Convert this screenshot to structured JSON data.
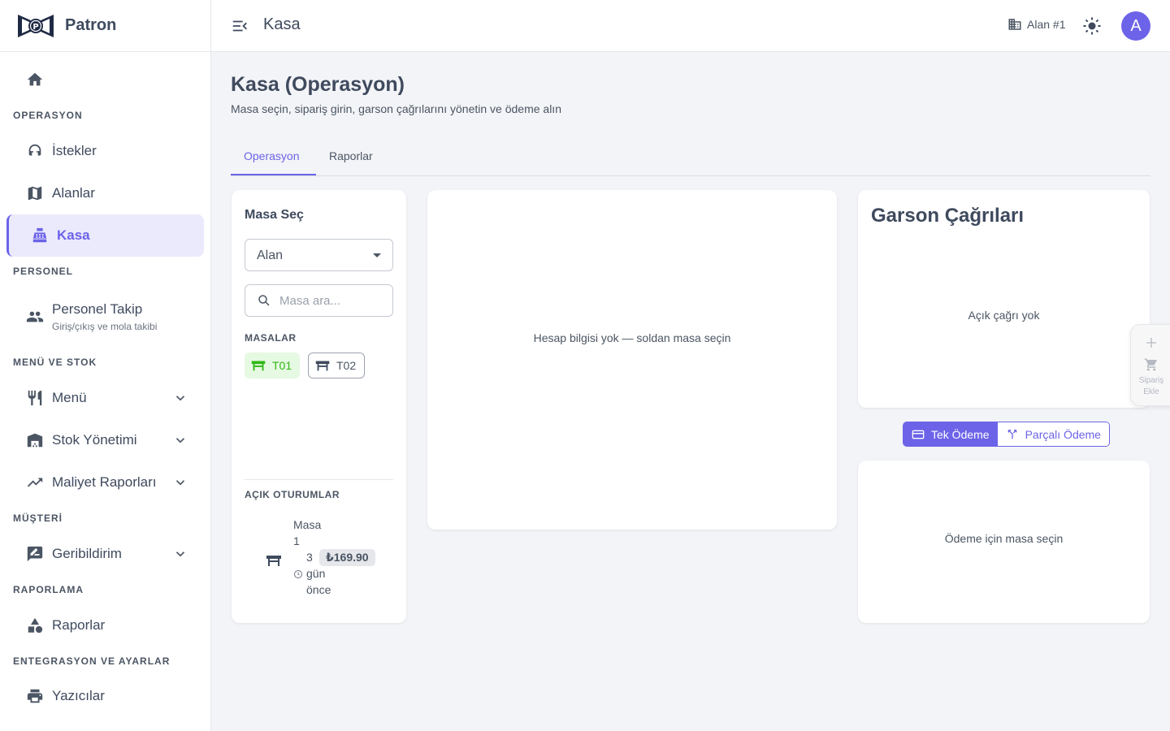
{
  "brand": {
    "name": "Patron"
  },
  "topbar": {
    "title": "Kasa",
    "area_label": "Alan #1",
    "avatar_initial": "A"
  },
  "sidebar": {
    "dashboard": "Dashboard",
    "sections": {
      "operasyon": "OPERASYON",
      "personel": "PERSONEL",
      "menu_stok": "MENÜ VE STOK",
      "musteri": "MÜŞTERİ",
      "raporlama": "RAPORLAMA",
      "entegrasyon": "ENTEGRASYON VE AYARLAR"
    },
    "items": {
      "istekler": "İstekler",
      "alanlar": "Alanlar",
      "kasa": "Kasa",
      "personel_takip": "Personel Takip",
      "personel_takip_sub": "Giriş/çıkış ve mola takibi",
      "menu": "Menü",
      "stok": "Stok Yönetimi",
      "maliyet": "Maliyet Raporları",
      "geribildirim": "Geribildirim",
      "raporlar": "Raporlar",
      "yazicilar": "Yazıcılar"
    }
  },
  "page": {
    "title": "Kasa (Operasyon)",
    "subtitle": "Masa seçin, sipariş girin, garson çağrılarını yönetin ve ödeme alın",
    "tabs": [
      "Operasyon",
      "Raporlar"
    ]
  },
  "masa_panel": {
    "title": "Masa Seç",
    "area_select": "Alan",
    "search_placeholder": "Masa ara...",
    "tables_label": "MASALAR",
    "tables": [
      "T01",
      "T02"
    ],
    "sessions_label": "AÇIK OTURUMLAR",
    "session": {
      "name": "Masa 1",
      "amount": "₺169.90",
      "ago_num": "3",
      "ago_text": "gün önce"
    }
  },
  "account_panel": {
    "empty": "Hesap bilgisi yok — soldan masa seçin"
  },
  "waiter_panel": {
    "title": "Garson Çağrıları",
    "empty": "Açık çağrı yok"
  },
  "payment": {
    "single": "Tek Ödeme",
    "split": "Parçalı Ödeme",
    "empty": "Ödeme için masa seçin"
  },
  "fab": {
    "label": "Sipariş Ekle"
  },
  "colors": {
    "accent": "#6c63e8",
    "green": "#2fb812"
  }
}
